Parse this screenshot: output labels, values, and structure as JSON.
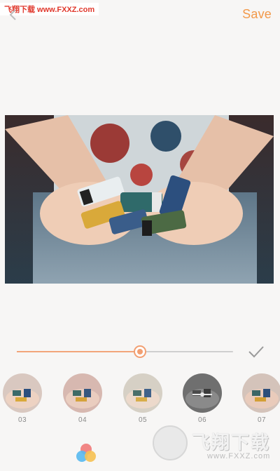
{
  "watermark_top": {
    "text": "飞翔下载 www.FXXZ.com"
  },
  "header": {
    "save_label": "Save"
  },
  "editor": {
    "intensity": 0.57
  },
  "filters": [
    {
      "label": "03"
    },
    {
      "label": "04"
    },
    {
      "label": "05"
    },
    {
      "label": "06"
    },
    {
      "label": "07"
    }
  ],
  "watermark_bottom": {
    "title": "飞翔下载",
    "url": "www.FXXZ.com"
  },
  "colors": {
    "accent": "#f2994a",
    "track": "#cfcfcf",
    "background": "#f7f6f5"
  },
  "icons": [
    "back-icon",
    "check-icon",
    "palette-icon"
  ]
}
